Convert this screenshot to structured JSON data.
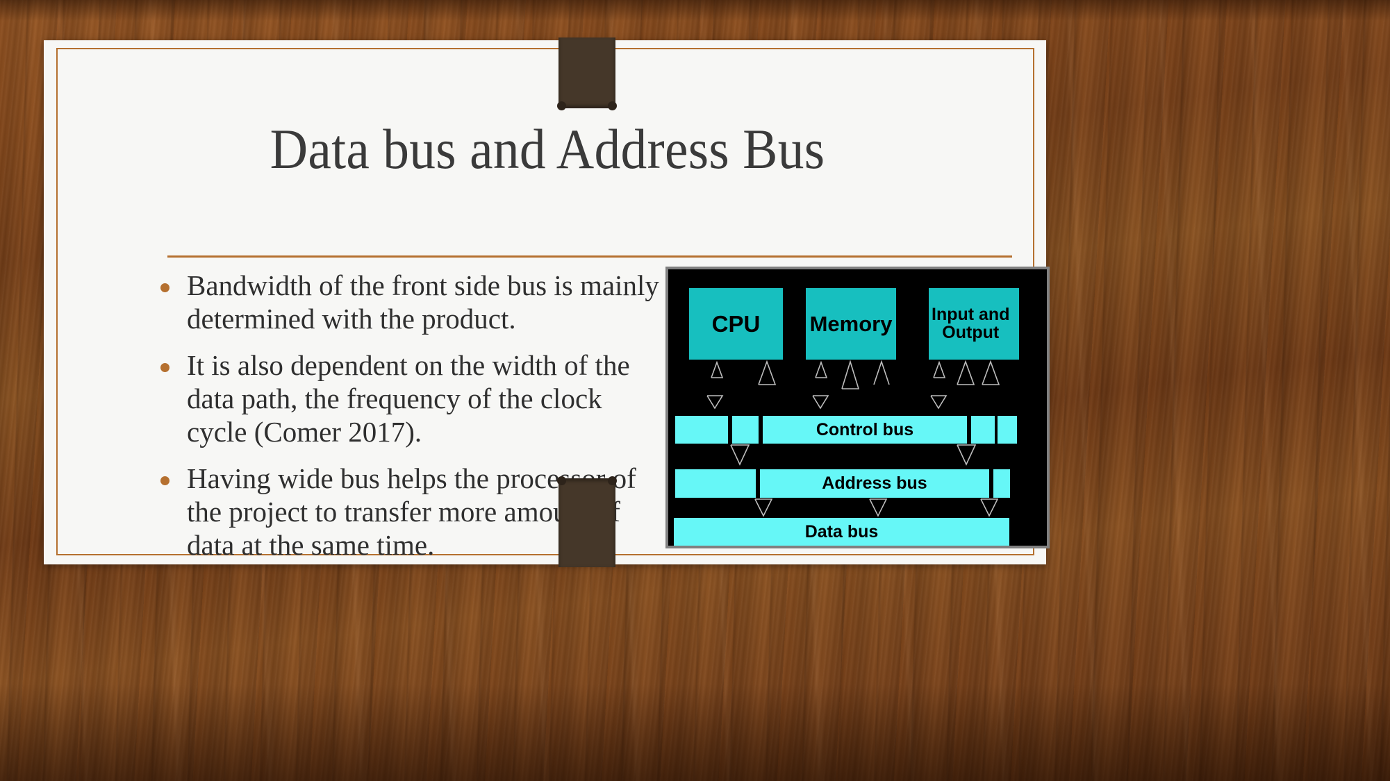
{
  "background": {
    "name": "wooden-desk",
    "color": "#7d4519"
  },
  "slide": {
    "paper_color": "#f7f7f5",
    "accent_color": "#b5702f",
    "clip_color": "#453729",
    "title": "Data bus and Address Bus",
    "bullets": [
      "Bandwidth of the front side bus is mainly determined with the product.",
      "It is also dependent on the width of the data path, the frequency of the clock cycle (Comer 2017).",
      "Having wide bus helps the processor of the project to transfer more amount of data at the same time."
    ]
  },
  "diagram": {
    "name": "computer-bus-architecture-diagram",
    "background_color": "#000000",
    "frame_color": "#808080",
    "unit_color": "#17bfbf",
    "bus_color": "#66f7f7",
    "units": [
      {
        "label": "CPU"
      },
      {
        "label": "Memory"
      },
      {
        "label": "Input and\nOutput"
      }
    ],
    "buses": [
      {
        "label": "Control bus"
      },
      {
        "label": "Address bus"
      },
      {
        "label": "Data bus"
      }
    ]
  }
}
